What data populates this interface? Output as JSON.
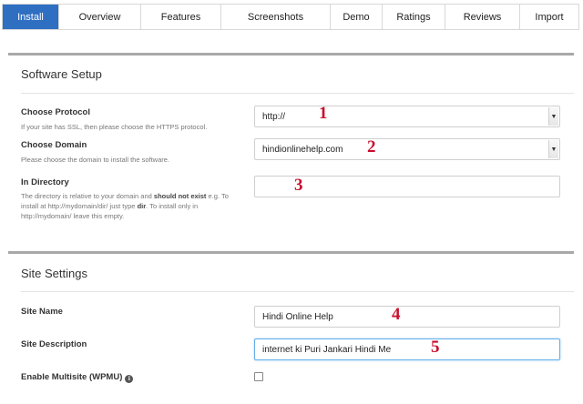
{
  "tabs": [
    "Install",
    "Overview",
    "Features",
    "Screenshots",
    "Demo",
    "Ratings",
    "Reviews",
    "Import"
  ],
  "software_setup": {
    "title": "Software Setup",
    "protocol": {
      "label": "Choose Protocol",
      "help": "If your site has SSL, then please choose the HTTPS protocol.",
      "value": "http://",
      "marker": "1"
    },
    "domain": {
      "label": "Choose Domain",
      "help": "Please choose the domain to install the software.",
      "value": "hindionlinehelp.com",
      "marker": "2"
    },
    "directory": {
      "label": "In Directory",
      "help_part1": "The directory is relative to your domain and",
      "help_bold1": "should not exist",
      "help_part2": "e.g. To install at http://mydomain/dir/ just type",
      "help_bold2": "dir",
      "help_part3": ". To install only in http://mydomain/ leave this empty.",
      "value": "",
      "marker": "3"
    }
  },
  "site_settings": {
    "title": "Site Settings",
    "site_name": {
      "label": "Site Name",
      "value": "Hindi Online Help",
      "marker": "4"
    },
    "site_description": {
      "label": "Site Description",
      "value": "internet ki Puri Jankari Hindi Me",
      "marker": "5"
    },
    "multisite": {
      "label": "Enable Multisite (WPMU)",
      "info_icon": "info-icon",
      "checked": false
    }
  },
  "colors": {
    "active_tab": "#2f6fc2",
    "marker": "#c8102e",
    "section_border": "#a8a8a8"
  }
}
